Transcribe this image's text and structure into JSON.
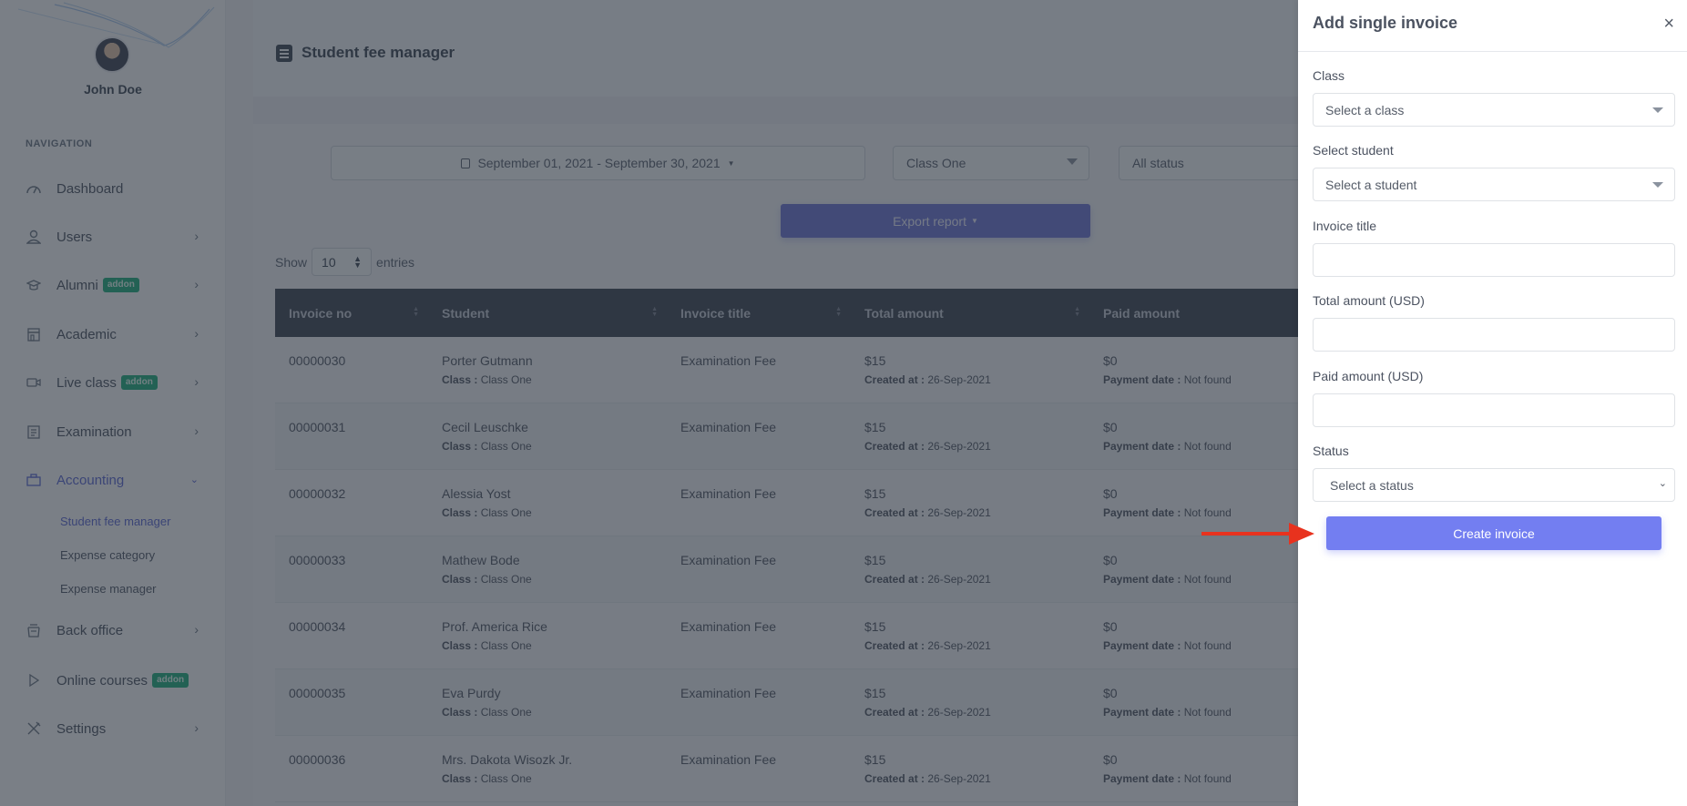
{
  "sidebar": {
    "user_name": "John Doe",
    "nav_heading": "NAVIGATION",
    "items": [
      {
        "label": "Dashboard",
        "icon": "dashboard-gauge-icon",
        "has_chevron": false
      },
      {
        "label": "Users",
        "icon": "user-icon",
        "has_chevron": true
      },
      {
        "label": "Alumni",
        "icon": "graduation-cap-icon",
        "badge": "addon",
        "has_chevron": true
      },
      {
        "label": "Academic",
        "icon": "building-icon",
        "has_chevron": true
      },
      {
        "label": "Live class",
        "icon": "video-camera-icon",
        "badge": "addon",
        "has_chevron": true
      },
      {
        "label": "Examination",
        "icon": "clipboard-icon",
        "has_chevron": true
      },
      {
        "label": "Accounting",
        "icon": "briefcase-icon",
        "has_chevron": true,
        "expanded": true,
        "active": true
      },
      {
        "label": "Back office",
        "icon": "basket-icon",
        "has_chevron": true
      },
      {
        "label": "Online courses",
        "icon": "play-icon",
        "badge": "addon",
        "has_chevron": false
      },
      {
        "label": "Settings",
        "icon": "tools-icon",
        "has_chevron": true
      }
    ],
    "accounting_sub": [
      {
        "label": "Student fee manager",
        "active": true
      },
      {
        "label": "Expense category"
      },
      {
        "label": "Expense manager"
      }
    ]
  },
  "header": {
    "title": "Student fee manager",
    "title_icon": "document-icon"
  },
  "filters": {
    "date_range": "September 01, 2021 - September 30, 2021",
    "class_selected": "Class One",
    "status_selected": "All status",
    "export_label": "Export report"
  },
  "entries": {
    "show_label": "Show",
    "value": "10",
    "suffix_label": "entries"
  },
  "table": {
    "columns": [
      "Invoice no",
      "Student",
      "Invoice title",
      "Total amount",
      "Paid amount"
    ],
    "sub_labels": {
      "class": "Class :",
      "created": "Created at :",
      "payment": "Payment date :"
    },
    "rows": [
      {
        "invoice_no": "00000030",
        "student": "Porter Gutmann",
        "class": "Class One",
        "title": "Examination Fee",
        "total": "$15",
        "created_at": "26-Sep-2021",
        "paid": "$0",
        "payment_date": "Not found"
      },
      {
        "invoice_no": "00000031",
        "student": "Cecil Leuschke",
        "class": "Class One",
        "title": "Examination Fee",
        "total": "$15",
        "created_at": "26-Sep-2021",
        "paid": "$0",
        "payment_date": "Not found"
      },
      {
        "invoice_no": "00000032",
        "student": "Alessia Yost",
        "class": "Class One",
        "title": "Examination Fee",
        "total": "$15",
        "created_at": "26-Sep-2021",
        "paid": "$0",
        "payment_date": "Not found"
      },
      {
        "invoice_no": "00000033",
        "student": "Mathew Bode",
        "class": "Class One",
        "title": "Examination Fee",
        "total": "$15",
        "created_at": "26-Sep-2021",
        "paid": "$0",
        "payment_date": "Not found"
      },
      {
        "invoice_no": "00000034",
        "student": "Prof. America Rice",
        "class": "Class One",
        "title": "Examination Fee",
        "total": "$15",
        "created_at": "26-Sep-2021",
        "paid": "$0",
        "payment_date": "Not found"
      },
      {
        "invoice_no": "00000035",
        "student": "Eva Purdy",
        "class": "Class One",
        "title": "Examination Fee",
        "total": "$15",
        "created_at": "26-Sep-2021",
        "paid": "$0",
        "payment_date": "Not found"
      },
      {
        "invoice_no": "00000036",
        "student": "Mrs. Dakota Wisozk Jr.",
        "class": "Class One",
        "title": "Examination Fee",
        "total": "$15",
        "created_at": "26-Sep-2021",
        "paid": "$0",
        "payment_date": "Not found"
      }
    ]
  },
  "panel": {
    "title": "Add single invoice",
    "close_symbol": "×",
    "fields": {
      "class_label": "Class",
      "class_placeholder": "Select a class",
      "student_label": "Select student",
      "student_placeholder": "Select a student",
      "invoice_title_label": "Invoice title",
      "invoice_title_value": "",
      "total_label": "Total amount (USD)",
      "total_value": "",
      "paid_label": "Paid amount (USD)",
      "paid_value": "",
      "status_label": "Status",
      "status_placeholder": "Select a status"
    },
    "submit_label": "Create invoice"
  },
  "colors": {
    "accent": "#737ef1",
    "table_header": "#3b4350",
    "badge": "#1bb07d",
    "annotation_arrow": "#e8321e"
  }
}
